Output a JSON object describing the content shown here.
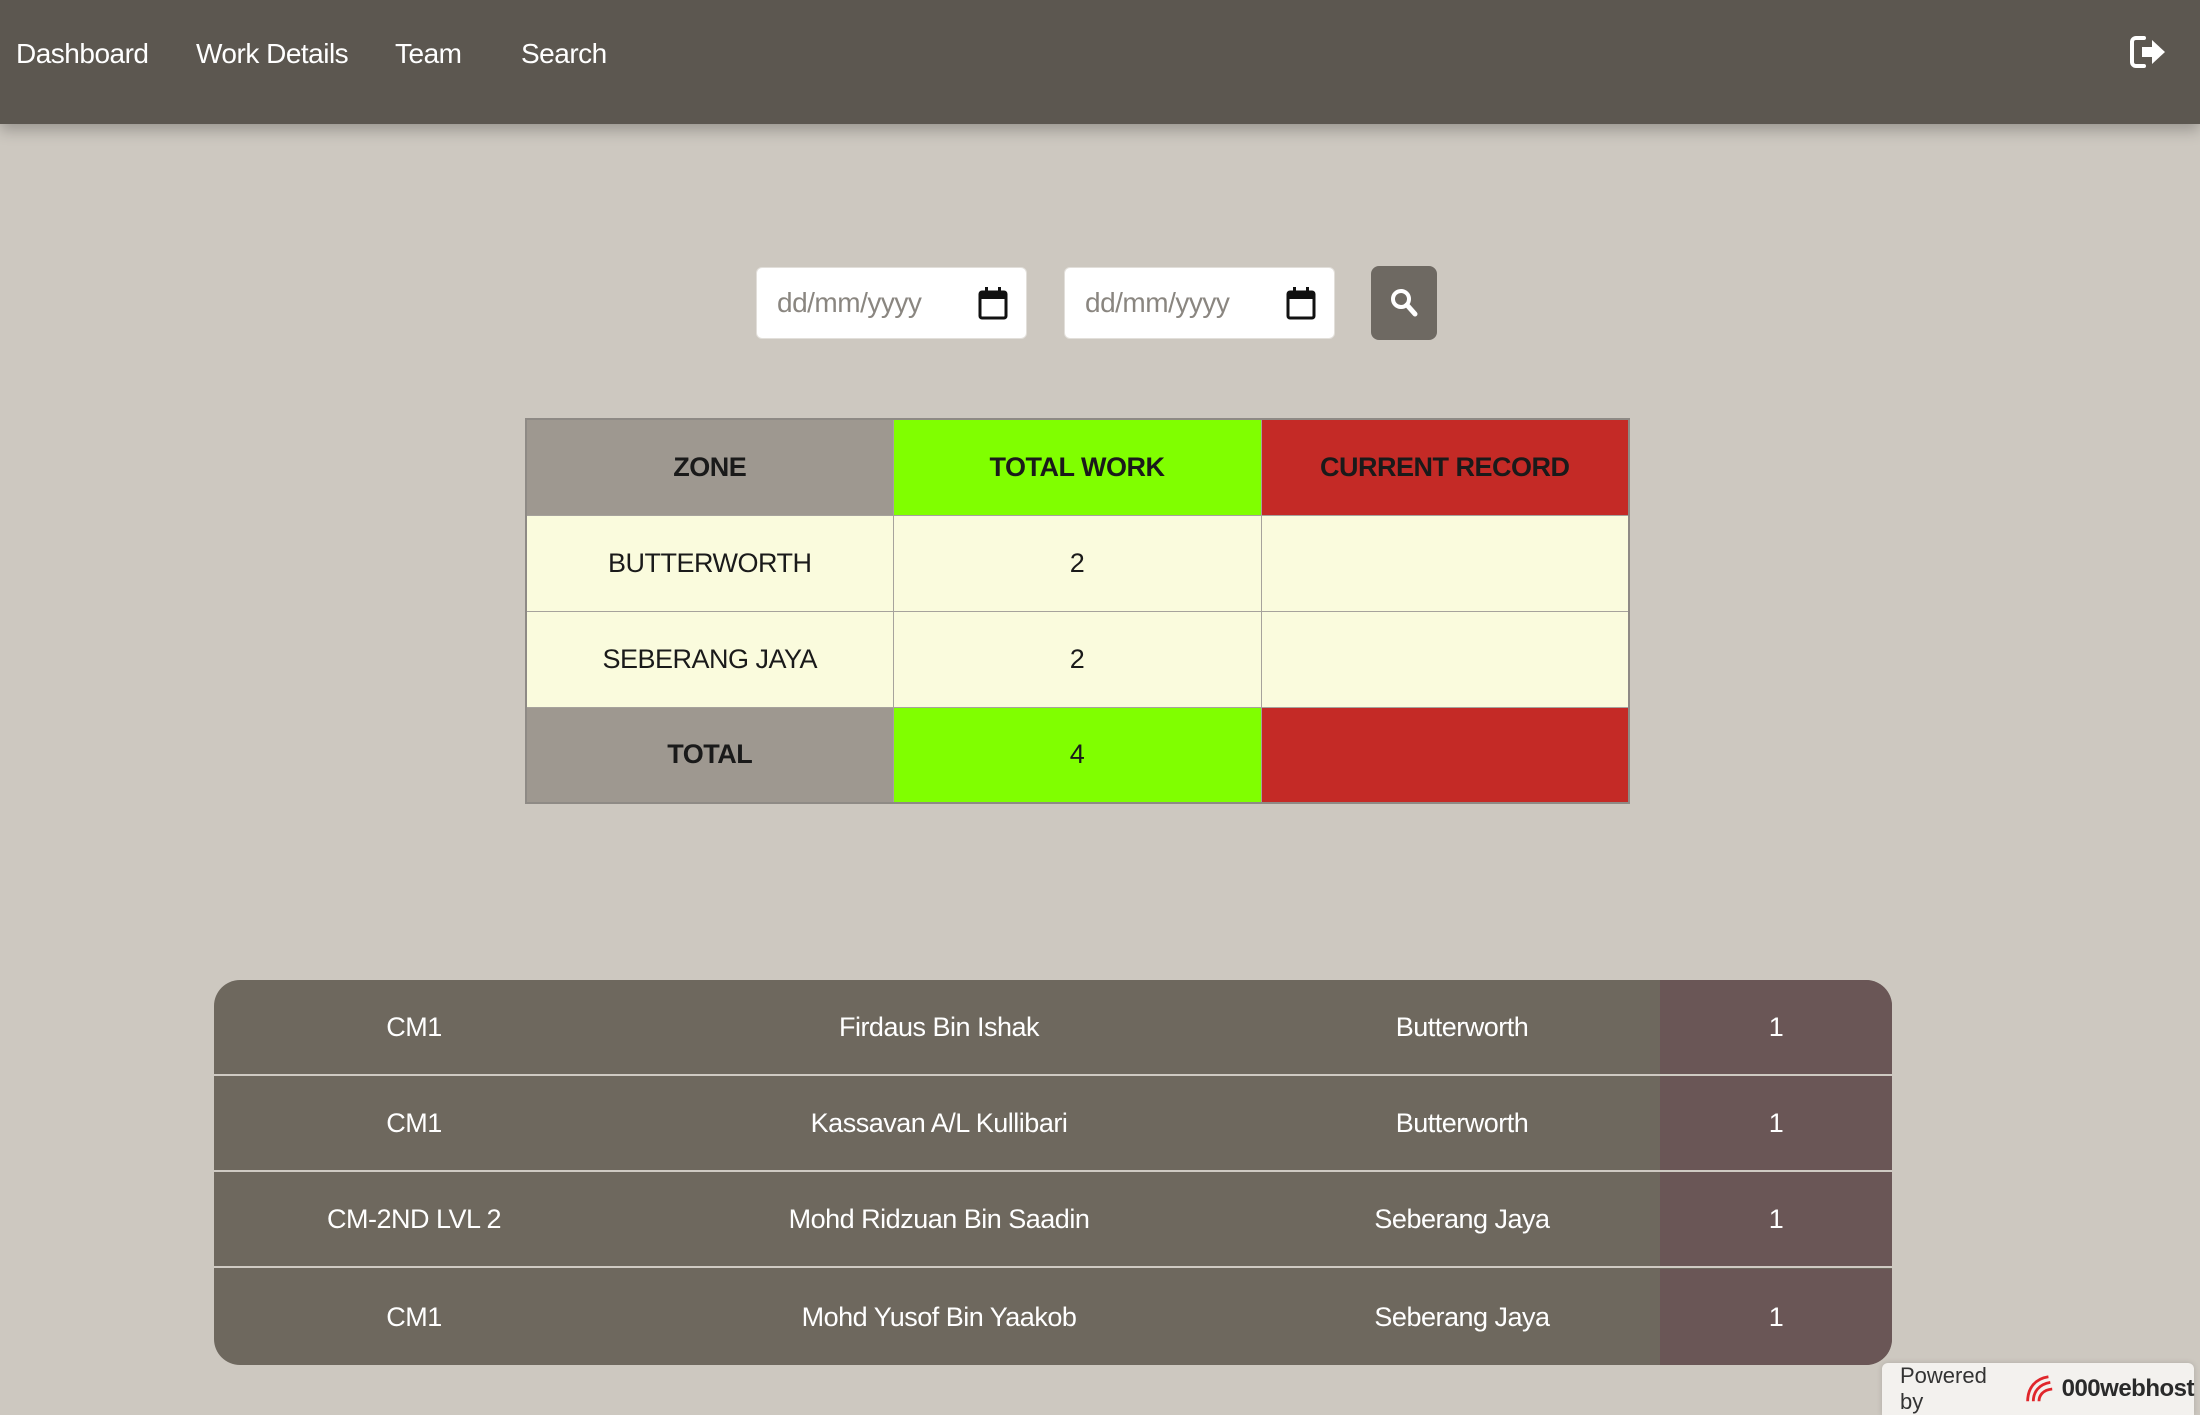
{
  "nav": {
    "items": [
      {
        "label": "Dashboard"
      },
      {
        "label": "Work Details"
      },
      {
        "label": "Team"
      },
      {
        "label": "Search"
      }
    ],
    "logout_icon": "sign-out-icon"
  },
  "filter": {
    "start_date": {
      "placeholder": "dd/mm/yyyy",
      "value": ""
    },
    "end_date": {
      "placeholder": "dd/mm/yyyy",
      "value": ""
    },
    "search_icon": "search-icon"
  },
  "summary": {
    "headers": {
      "zone": "ZONE",
      "total_work": "TOTAL WORK",
      "current_record": "CURRENT RECORD"
    },
    "rows": [
      {
        "zone": "BUTTERWORTH",
        "total_work": "2",
        "current_record": ""
      },
      {
        "zone": "SEBERANG JAYA",
        "total_work": "2",
        "current_record": ""
      }
    ],
    "total": {
      "label": "TOTAL",
      "total_work": "4",
      "current_record": ""
    },
    "colors": {
      "zone_header": "#9e9890",
      "total_work": "#80ff00",
      "current_record": "#c42a26",
      "body": "#fafbdd"
    }
  },
  "team": {
    "rows": [
      {
        "code": "CM1",
        "name": "Firdaus Bin Ishak",
        "zone": "Butterworth",
        "count": "1"
      },
      {
        "code": "CM1",
        "name": "Kassavan A/L Kullibari",
        "zone": "Butterworth",
        "count": "1"
      },
      {
        "code": "CM-2ND LVL 2",
        "name": "Mohd Ridzuan Bin Saadin",
        "zone": "Seberang Jaya",
        "count": "1"
      },
      {
        "code": "CM1",
        "name": "Mohd Yusof Bin Yaakob",
        "zone": "Seberang Jaya",
        "count": "1"
      }
    ]
  },
  "footer": {
    "powered_by": "Powered by",
    "brand": "000webhost"
  }
}
